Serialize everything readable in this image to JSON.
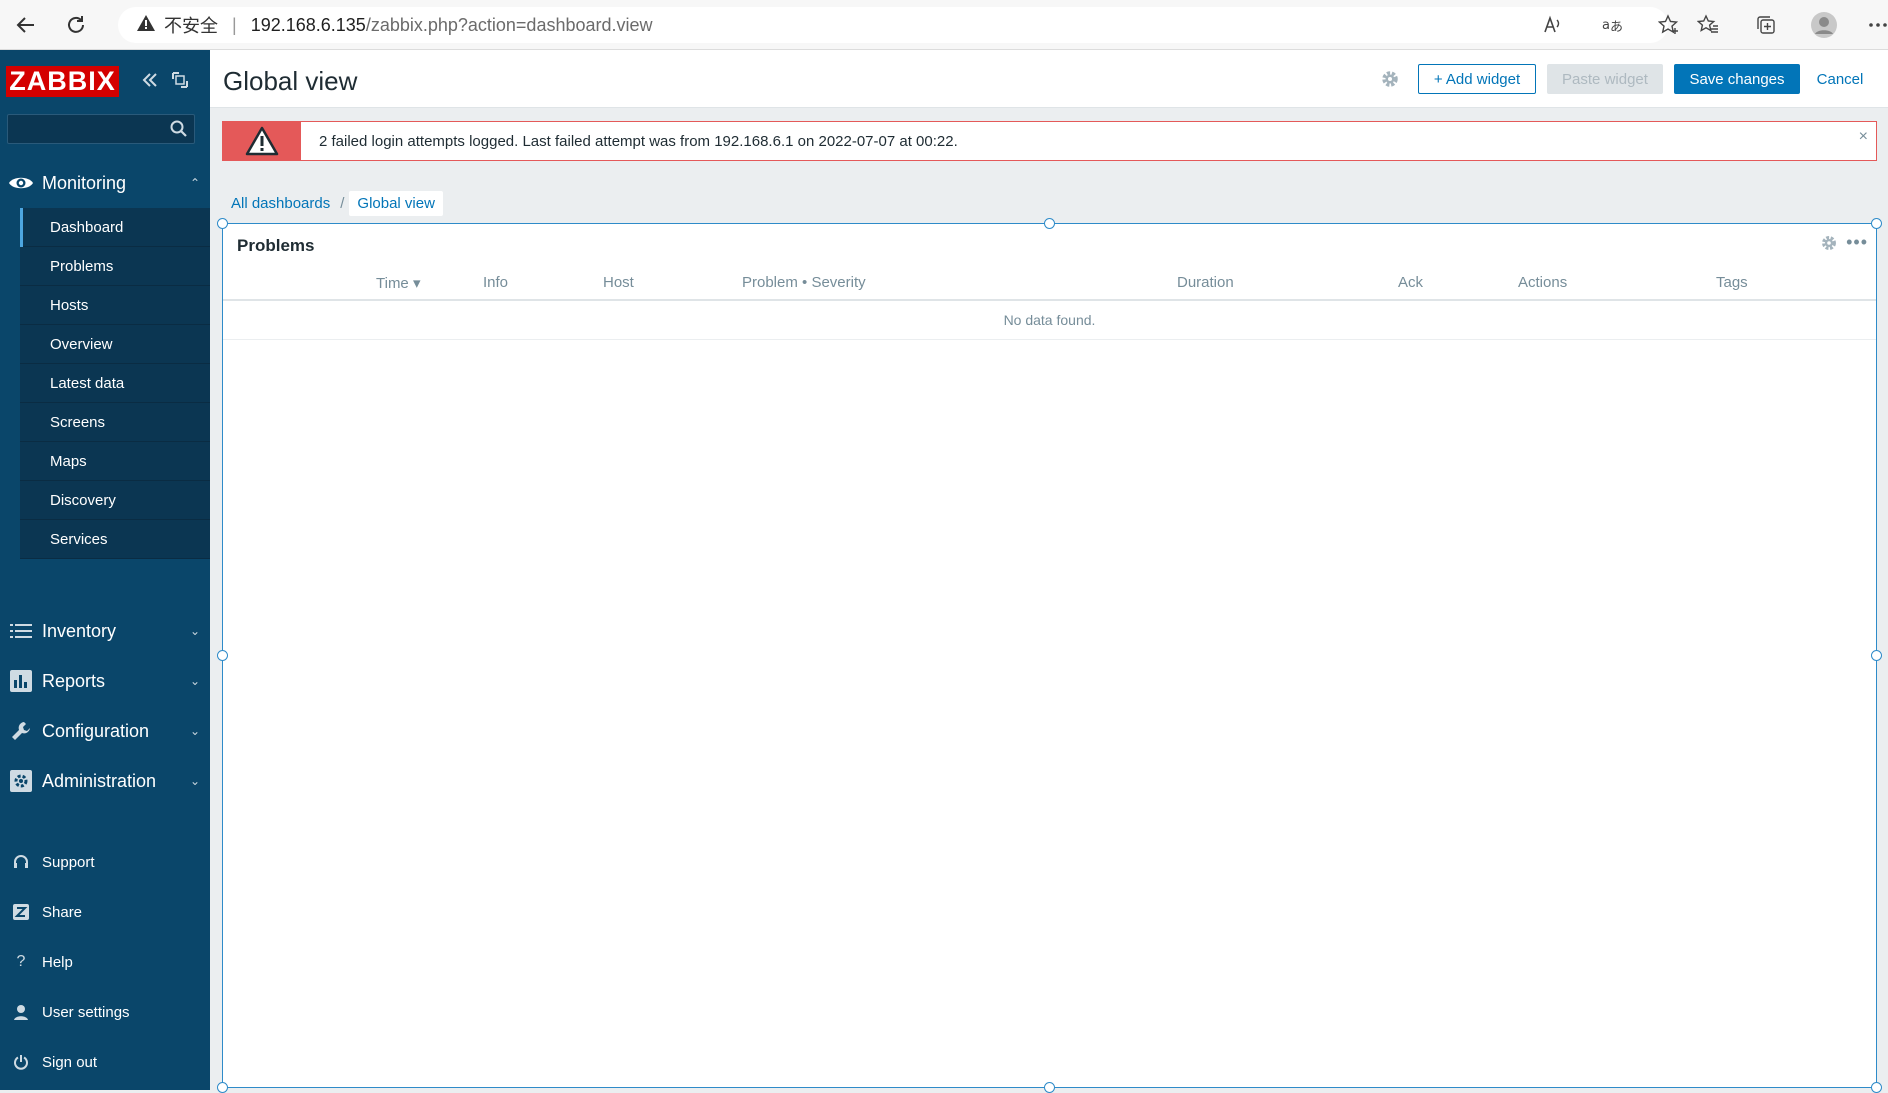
{
  "browser": {
    "insecure_label": "不安全",
    "separator": "|",
    "url_host": "192.168.6.135",
    "url_path": "/zabbix.php?action=dashboard.view"
  },
  "sidebar": {
    "logo": "ZABBIX",
    "search_placeholder": "",
    "monitoring": {
      "label": "Monitoring",
      "items": [
        {
          "label": "Dashboard"
        },
        {
          "label": "Problems"
        },
        {
          "label": "Hosts"
        },
        {
          "label": "Overview"
        },
        {
          "label": "Latest data"
        },
        {
          "label": "Screens"
        },
        {
          "label": "Maps"
        },
        {
          "label": "Discovery"
        },
        {
          "label": "Services"
        }
      ]
    },
    "inventory": "Inventory",
    "reports": "Reports",
    "configuration": "Configuration",
    "administration": "Administration",
    "footer": {
      "support": "Support",
      "share": "Share",
      "help": "Help",
      "user_settings": "User settings",
      "sign_out": "Sign out"
    }
  },
  "header": {
    "title": "Global view",
    "add_widget": "+ Add widget",
    "paste_widget": "Paste widget",
    "save_changes": "Save changes",
    "cancel": "Cancel"
  },
  "alert": {
    "message": "2 failed login attempts logged. Last failed attempt was from 192.168.6.1 on 2022-07-07 at 00:22.",
    "close": "×"
  },
  "breadcrumb": {
    "all": "All dashboards",
    "sep": "/",
    "current": "Global view"
  },
  "widget": {
    "title": "Problems",
    "more": "•••",
    "columns": {
      "time": "Time ▾",
      "info": "Info",
      "host": "Host",
      "problem": "Problem • Severity",
      "duration": "Duration",
      "ack": "Ack",
      "actions": "Actions",
      "tags": "Tags"
    },
    "empty": "No data found."
  },
  "colors": {
    "sidebar": "#0a466a",
    "accent": "#0275b8",
    "alert": "#e45959",
    "logo": "#d40000"
  }
}
